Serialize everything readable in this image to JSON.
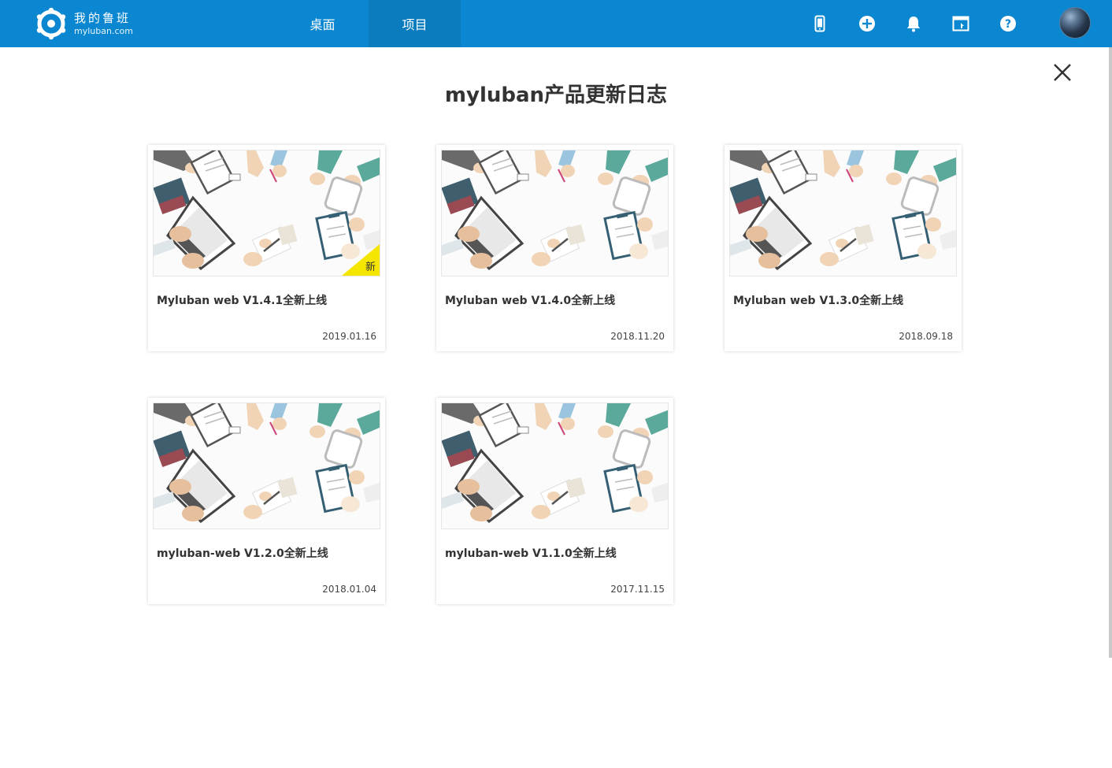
{
  "header": {
    "logo_title": "我的鲁班",
    "logo_subtitle": "myluban.com",
    "brand_color": "#0a87d0",
    "tabs": [
      {
        "label": "桌面",
        "active": false
      },
      {
        "label": "项目",
        "active": true
      }
    ],
    "icons": [
      "mobile-icon",
      "add-circle-icon",
      "bell-icon",
      "browser-window-icon",
      "help-icon"
    ]
  },
  "main": {
    "title": "myluban产品更新日志",
    "cards": [
      {
        "title": "Myluban web V1.4.1全新上线",
        "date": "2019.01.16",
        "badge": "新"
      },
      {
        "title": "Myluban web V1.4.0全新上线",
        "date": "2018.11.20"
      },
      {
        "title": "Myluban web V1.3.0全新上线",
        "date": "2018.09.18"
      },
      {
        "title": "myluban-web V1.2.0全新上线",
        "date": "2018.01.04"
      },
      {
        "title": "myluban-web V1.1.0全新上线",
        "date": "2017.11.15"
      }
    ]
  }
}
